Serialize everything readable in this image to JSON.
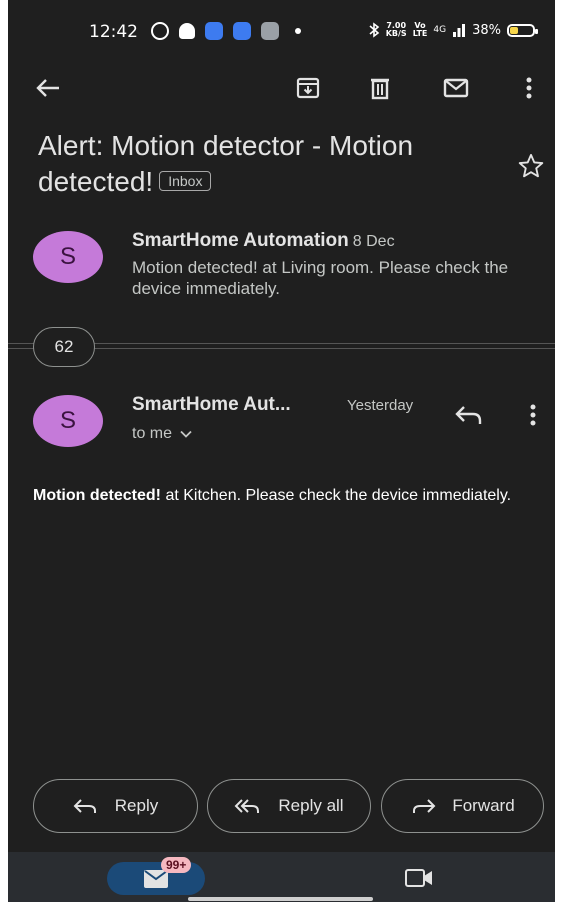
{
  "status_bar": {
    "time": "12:42",
    "speed": "7.00",
    "speed_unit": "KB/S",
    "volte": "Vo",
    "lte": "LTE",
    "network": "4G",
    "battery": "38%",
    "battery_level": 0.38,
    "icons": [
      "whatsapp-icon",
      "snapchat-icon",
      "app-icon",
      "app-icon",
      "settings-icon",
      "bluetooth-icon",
      "signal-icon"
    ]
  },
  "toolbar": {
    "icons": [
      "back-arrow-icon",
      "archive-icon",
      "delete-icon",
      "mail-icon",
      "more-vert-icon"
    ]
  },
  "subject": {
    "text": "Alert: Motion detector - Motion detected!",
    "label": "Inbox"
  },
  "message_collapsed": {
    "avatar_letter": "S",
    "sender": "SmartHome Automation",
    "date": "8 Dec",
    "snippet": "Motion detected! at Living room. Please check the device immediately."
  },
  "collapsed_count": "62",
  "message_open": {
    "avatar_letter": "S",
    "sender": "SmartHome Aut...",
    "date": "Yesterday",
    "recipient": "to me",
    "body_bold": "Motion detected!",
    "body_rest": " at Kitchen. Please check the device immediately."
  },
  "actions": {
    "reply": "Reply",
    "reply_all": "Reply all",
    "forward": "Forward"
  },
  "bottom_nav": {
    "mail_badge": "99+"
  },
  "colors": {
    "background": "#1f1f1f",
    "avatar": "#c57ad9",
    "nav_mail_active": "#1b4a78",
    "badge": "#f5b8c0"
  }
}
